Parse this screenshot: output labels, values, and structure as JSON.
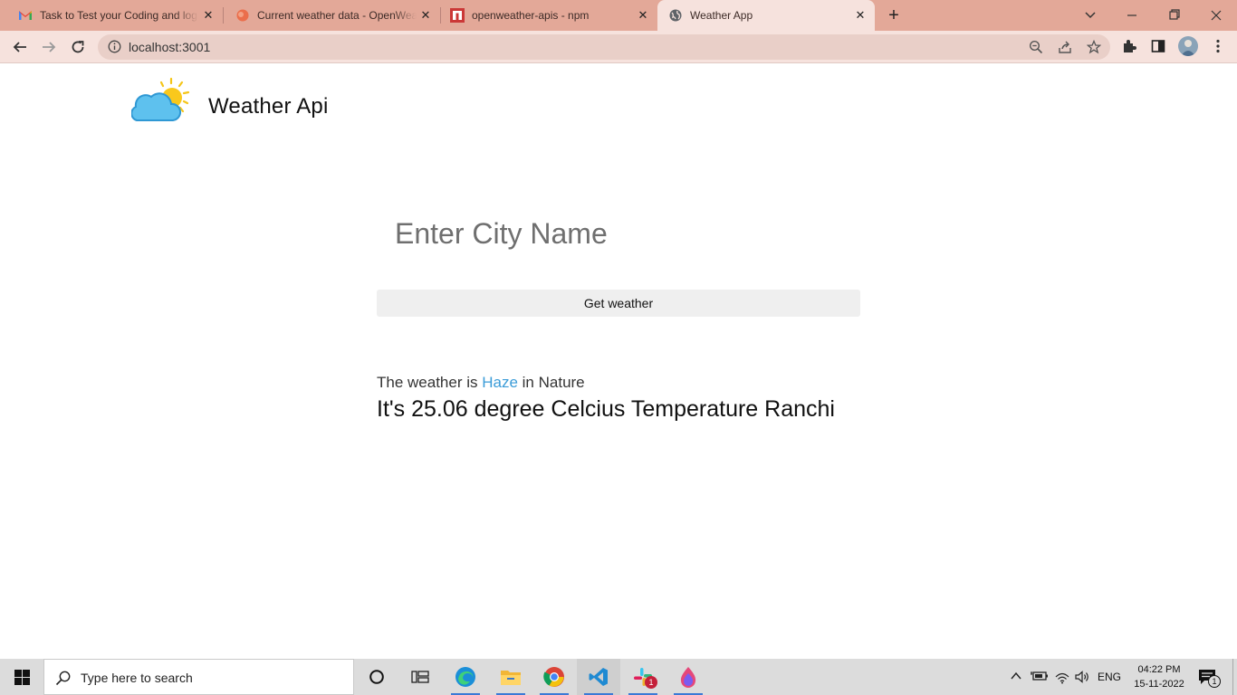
{
  "browser": {
    "tabs": [
      {
        "title": "Task to Test your Coding and logic",
        "favicon": "gmail-icon"
      },
      {
        "title": "Current weather data - OpenWeather",
        "favicon": "openweather-icon"
      },
      {
        "title": "openweather-apis - npm",
        "favicon": "npm-icon"
      },
      {
        "title": "Weather App",
        "favicon": "globe-icon"
      }
    ],
    "active_tab_index": 3,
    "url": "localhost:3001"
  },
  "page": {
    "brand": "Weather Api",
    "city_placeholder": "Enter City Name",
    "button_label": "Get weather",
    "result": {
      "prefix": "The weather is",
      "condition": "Haze",
      "suffix": "in Nature",
      "temperature_line": "It's 25.06 degree Celcius Temperature Ranchi"
    },
    "colors": {
      "condition": "#3b9cd8",
      "tab_strip": "#e3a898",
      "toolbar": "#f6e2dd"
    }
  },
  "taskbar": {
    "search_placeholder": "Type here to search",
    "language": "ENG",
    "time": "04:22 PM",
    "date": "15-11-2022",
    "slack_badge": "1",
    "notification_count": "1"
  }
}
